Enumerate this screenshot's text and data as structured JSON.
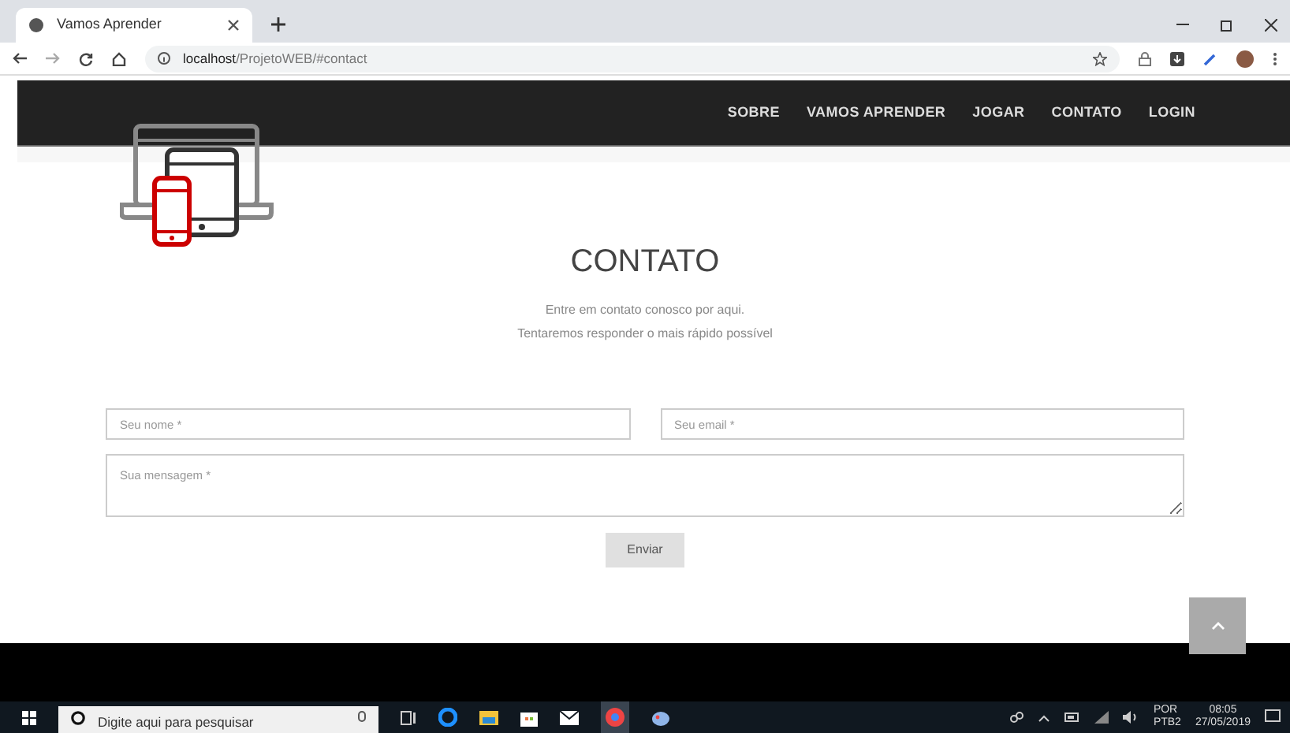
{
  "browser": {
    "tab_title": "Vamos Aprender",
    "url_host": "localhost",
    "url_path": "/ProjetoWEB/#contact"
  },
  "nav": [
    {
      "label": "SOBRE"
    },
    {
      "label": "VAMOS APRENDER"
    },
    {
      "label": "JOGAR"
    },
    {
      "label": "CONTATO"
    },
    {
      "label": "LOGIN"
    }
  ],
  "contact": {
    "title": "CONTATO",
    "lines": [
      "Entre em contato conosco por aqui.",
      "Tentaremos responder o mais rápido possível"
    ],
    "name_field": {
      "placeholder": "Seu nome *"
    },
    "email_field": {
      "placeholder": "Seu email *"
    },
    "message_field": {
      "placeholder": "Sua mensagem *"
    },
    "submit": "Enviar"
  },
  "taskbar": {
    "search": {
      "placeholder": "Digite aqui para pesquisar"
    },
    "language": "POR",
    "layout": "PTB2",
    "time": "08:05",
    "date": "27/05/2019"
  }
}
